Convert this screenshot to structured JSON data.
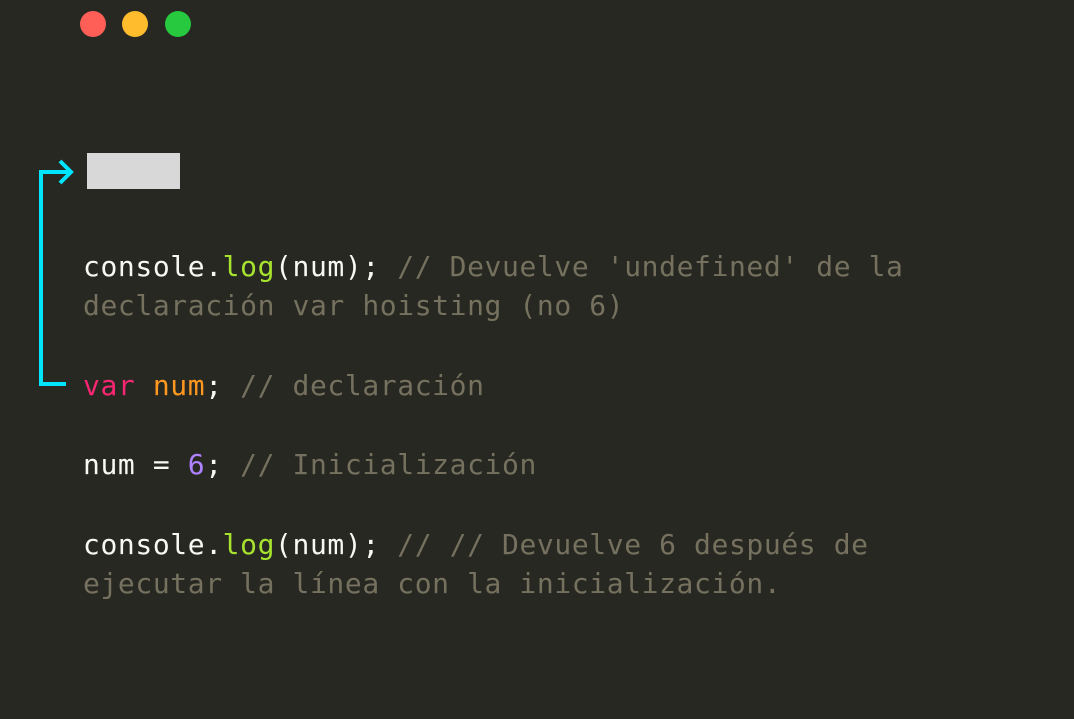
{
  "window_controls": {
    "close_color": "#ff5f56",
    "minimize_color": "#ffbd2e",
    "maximize_color": "#27c93f"
  },
  "colors": {
    "background": "#272822",
    "arrow": "#00e5ff",
    "placeholder": "#d8d8d8"
  },
  "code": {
    "line1": {
      "obj": "console",
      "dot": ".",
      "fn": "log",
      "args": "(num);",
      "comment": " // Devuelve 'undefined' de la",
      "comment_cont": "declaración var hoisting (no 6)"
    },
    "line2": {
      "keyword": "var",
      "space": " ",
      "name": "num",
      "end": ";",
      "comment": " // declaración"
    },
    "line3": {
      "name": "num = ",
      "value": "6",
      "end": ";",
      "comment": " // Inicialización"
    },
    "line4": {
      "obj": "console",
      "dot": ".",
      "fn": "log",
      "args": "(num);",
      "comment": " // // Devuelve 6 después de",
      "comment_cont": "ejecutar la línea con la inicialización."
    }
  }
}
